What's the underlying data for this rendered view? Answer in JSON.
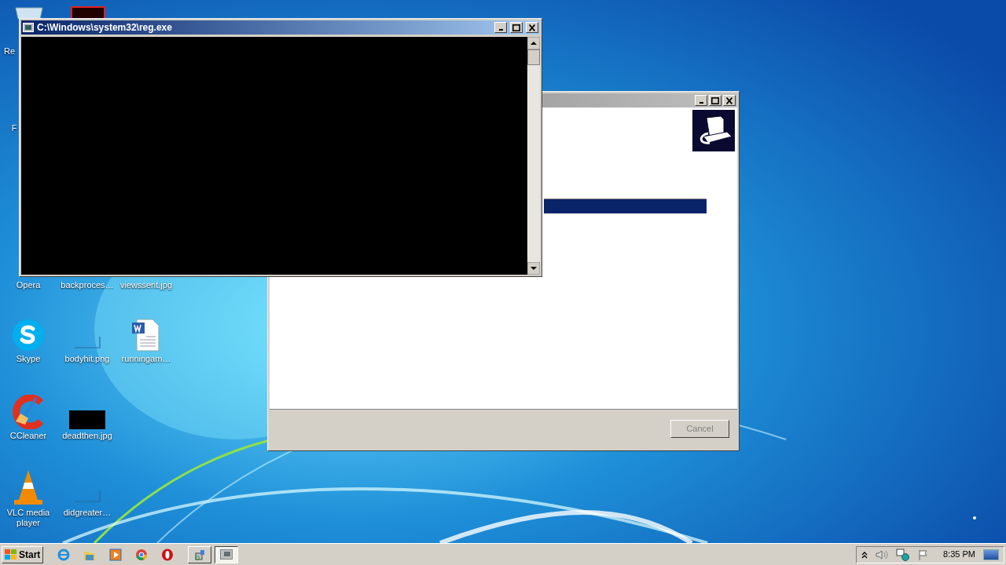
{
  "desktop_icons": [
    {
      "kind": "none",
      "label": "Re"
    },
    {
      "kind": "none",
      "label": "F"
    },
    {
      "kind": "none",
      "label": "Opera"
    },
    {
      "kind": "none",
      "label": "backproces…"
    },
    {
      "kind": "none",
      "label": "viewssent.jpg"
    },
    {
      "kind": "skype",
      "label": "Skype"
    },
    {
      "kind": "blank",
      "label": "bodyhit.png"
    },
    {
      "kind": "word",
      "label": "runningam…"
    },
    {
      "kind": "ccleaner",
      "label": "CCleaner"
    },
    {
      "kind": "dark",
      "label": "deadthen.jpg"
    },
    {
      "kind": "vlc",
      "label": "VLC media player"
    },
    {
      "kind": "blank",
      "label": "didgreater…"
    }
  ],
  "installer_window": {
    "active": false,
    "progress": {
      "level": 1
    },
    "cancel": {
      "label": "Cancel",
      "disabled": true
    }
  },
  "console_window": {
    "title": "C:\\Windows\\system32\\reg.exe",
    "active": true
  },
  "taskbar": {
    "start": "Start",
    "quick_launch": [
      {
        "kind": "ie"
      },
      {
        "kind": "folder"
      },
      {
        "kind": "media"
      },
      {
        "kind": "chrome"
      },
      {
        "kind": "opera"
      }
    ],
    "tasks": [
      {
        "kind": "installer",
        "selected": false
      },
      {
        "kind": "console",
        "selected": true
      }
    ],
    "clock": "8:35 PM"
  }
}
